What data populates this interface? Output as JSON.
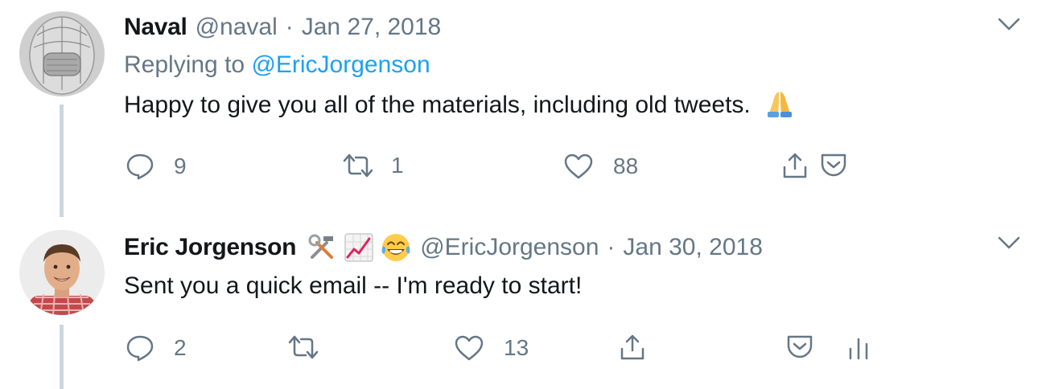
{
  "tweets": [
    {
      "name": "Naval",
      "handle": "@naval",
      "separator": "·",
      "date": "Jan 27, 2018",
      "replying_label": "Replying to",
      "replying_to": "@EricJorgenson",
      "text": "Happy to give you all of the materials, including old tweets.",
      "text_emoji": "folded-hands-emoji",
      "actions": {
        "reply_count": "9",
        "retweet_count": "1",
        "like_count": "88"
      }
    },
    {
      "name": "Eric Jorgenson",
      "name_emojis": [
        "hammer-and-wrench-emoji",
        "chart-increasing-emoji",
        "tears-of-joy-emoji"
      ],
      "handle": "@EricJorgenson",
      "separator": "·",
      "date": "Jan 30, 2018",
      "text": "Sent you a quick email -- I'm ready to start!",
      "actions": {
        "reply_count": "2",
        "retweet_count": "",
        "like_count": "13"
      }
    }
  ],
  "colors": {
    "text": "#14171a",
    "muted": "#657786",
    "link": "#1da1f2",
    "thread_line": "#ccd6dd"
  }
}
